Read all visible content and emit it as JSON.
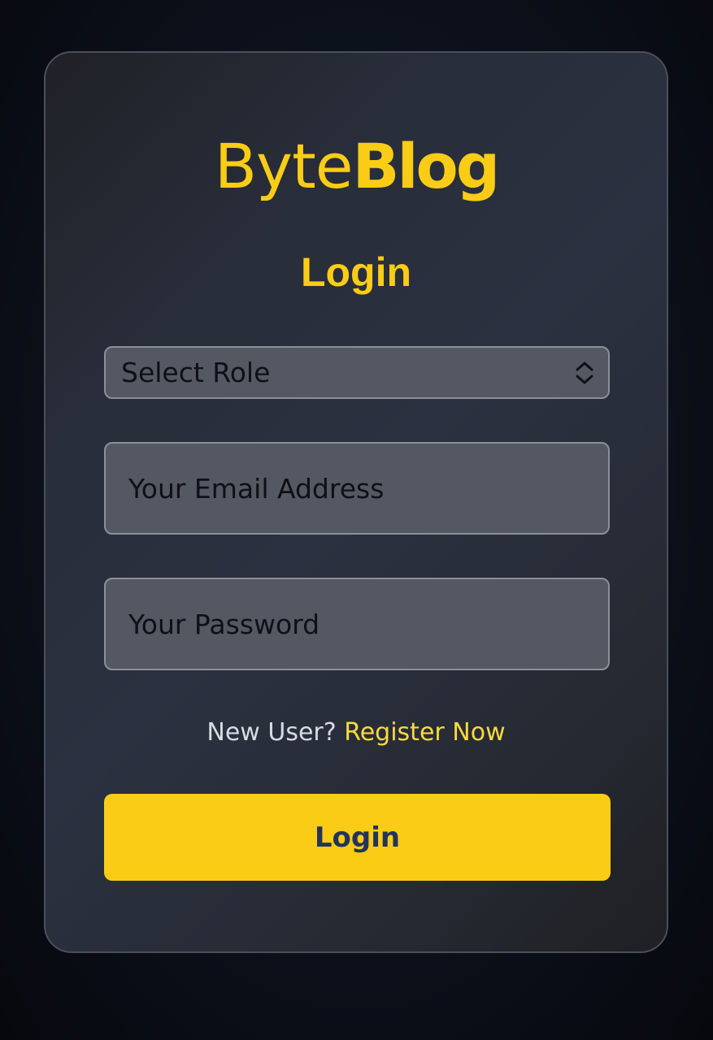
{
  "colors": {
    "accent": "#facc15",
    "button_text": "#24335c",
    "field_bg": "#545862"
  },
  "brand": {
    "part1": "Byte",
    "part2": "Blog"
  },
  "form": {
    "heading": "Login",
    "role_select": {
      "selected": "Select Role",
      "icon": "chevron-updown-icon"
    },
    "email_input": {
      "placeholder": "Your Email Address",
      "value": ""
    },
    "password_input": {
      "placeholder": "Your Password",
      "value": ""
    },
    "register_prompt": "New User?",
    "register_link": "Register Now",
    "submit_label": "Login"
  }
}
